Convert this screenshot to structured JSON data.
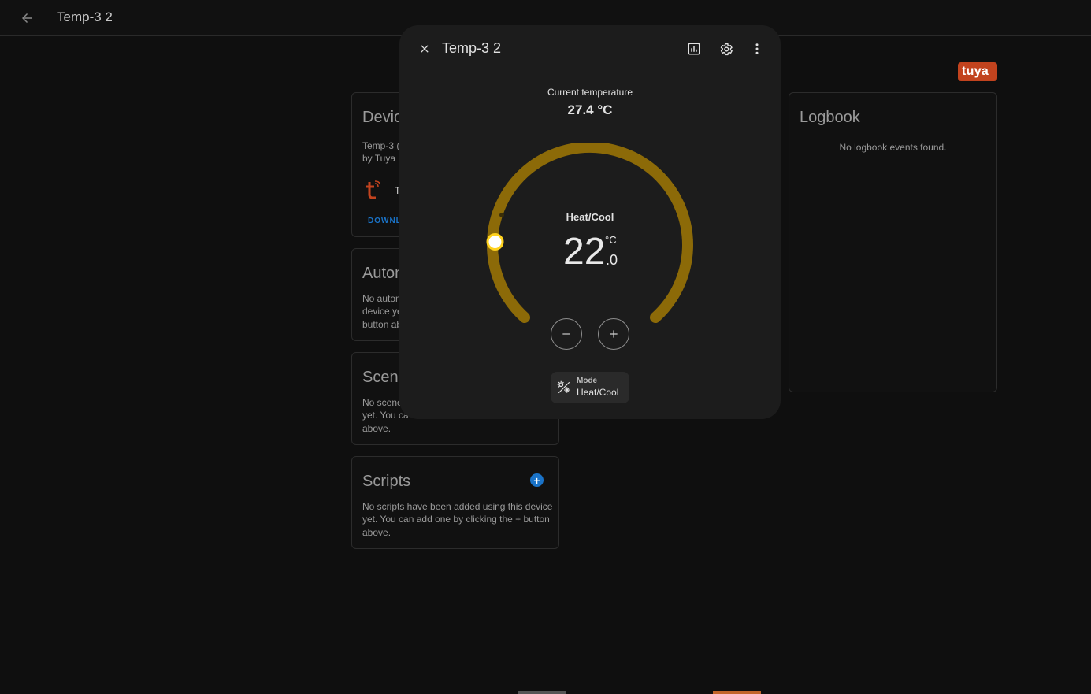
{
  "header": {
    "title": "Temp-3 2"
  },
  "brand": {
    "logo_text": "tuya",
    "accent": "#c2431e"
  },
  "device_card": {
    "title": "Devic",
    "model_line": "Temp-3 (",
    "manufacturer": "by Tuya",
    "integration_label": "T",
    "download_label": "DOWNL"
  },
  "automations_card": {
    "title": "Autom",
    "lines": [
      "No autom",
      "device ye",
      "button ab"
    ]
  },
  "scenes_card": {
    "title": "Scene",
    "lines": [
      "No scene",
      "yet. You ca",
      "above."
    ]
  },
  "scripts_card": {
    "title": "Scripts",
    "add_icon": "+",
    "lines": [
      "No scripts have been added using this device",
      "yet. You can add one by clicking the + button",
      "above."
    ]
  },
  "logbook_card": {
    "title": "Logbook",
    "empty_text": "No logbook events found."
  },
  "dialog": {
    "title": "Temp-3 2",
    "current_label": "Current temperature",
    "current_value": "27.4 °C",
    "hvac_mode_label": "Heat/Cool",
    "target_int": "22",
    "target_unit": "°C",
    "target_dec": ".0",
    "target_temperature": 22.0,
    "gauge_color": "#8c6a08",
    "handle_color": "#ffd21e",
    "mode_chip_label": "Mode",
    "mode_chip_value": "Heat/Cool"
  }
}
